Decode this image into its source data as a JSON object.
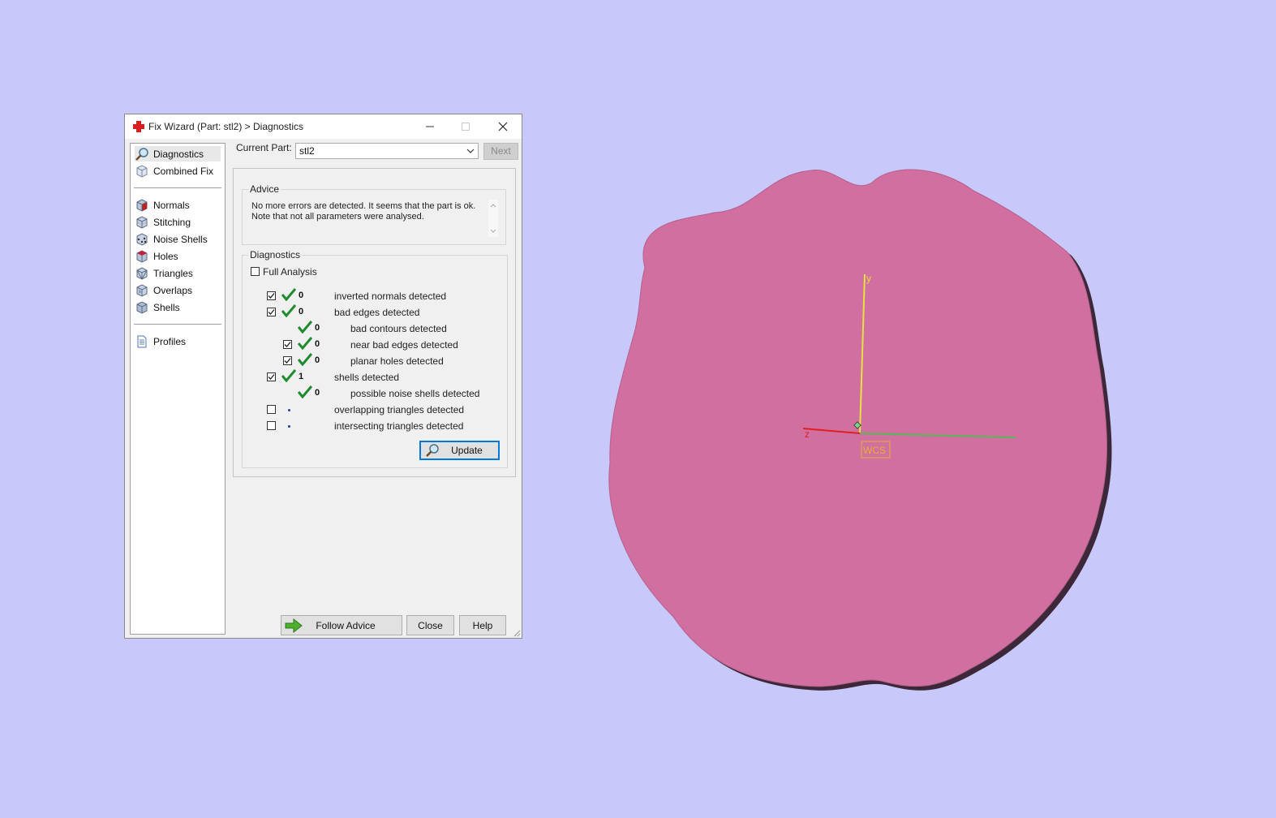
{
  "dialog": {
    "title": "Fix Wizard (Part: stl2) > Diagnostics",
    "icon": "red-cross-icon"
  },
  "sidebar": {
    "items": [
      {
        "label": "Diagnostics",
        "icon": "magnifier-icon",
        "selected": true
      },
      {
        "label": "Combined Fix",
        "icon": "cube-icon"
      },
      {
        "label": "Normals",
        "icon": "cube-red-face-icon"
      },
      {
        "label": "Stitching",
        "icon": "cube-stitch-icon"
      },
      {
        "label": "Noise Shells",
        "icon": "cube-dots-icon"
      },
      {
        "label": "Holes",
        "icon": "cube-hole-icon"
      },
      {
        "label": "Triangles",
        "icon": "cube-triangle-icon"
      },
      {
        "label": "Overlaps",
        "icon": "cube-overlap-icon"
      },
      {
        "label": "Shells",
        "icon": "cube-shell-icon"
      },
      {
        "label": "Profiles",
        "icon": "document-icon"
      }
    ]
  },
  "current_part": {
    "label": "Current Part:",
    "value": "stl2",
    "next_label": "Next"
  },
  "advice": {
    "title": "Advice",
    "line1": "No more errors are detected. It seems that the part is ok.",
    "line2": "Note that not all parameters were analysed."
  },
  "diagnostics": {
    "title": "Diagnostics",
    "full_analysis": "Full Analysis",
    "rows": [
      {
        "count": "0",
        "label": "inverted normals detected",
        "checked": true,
        "status": "ok"
      },
      {
        "count": "0",
        "label": "bad edges detected",
        "checked": true,
        "status": "ok"
      },
      {
        "count": "0",
        "label": "bad contours detected",
        "status": "ok"
      },
      {
        "count": "0",
        "label": "near bad edges detected",
        "checked": true,
        "status": "ok"
      },
      {
        "count": "0",
        "label": "planar holes detected",
        "checked": true,
        "status": "ok"
      },
      {
        "count": "1",
        "label": "shells detected",
        "checked": true,
        "status": "ok"
      },
      {
        "count": "0",
        "label": "possible noise shells detected",
        "status": "ok"
      },
      {
        "count": "",
        "label": "overlapping triangles detected",
        "checked": false,
        "status": "not-analysed"
      },
      {
        "count": "",
        "label": "intersecting triangles detected",
        "checked": false,
        "status": "not-analysed"
      }
    ],
    "update_label": "Update"
  },
  "buttons": {
    "follow_advice": "Follow Advice",
    "close": "Close",
    "help": "Help"
  },
  "viewport": {
    "background": "#c8c8fa",
    "model_color": "#d06fa0",
    "axes": {
      "y": "y",
      "z": "z",
      "wcs": "WCS"
    }
  }
}
